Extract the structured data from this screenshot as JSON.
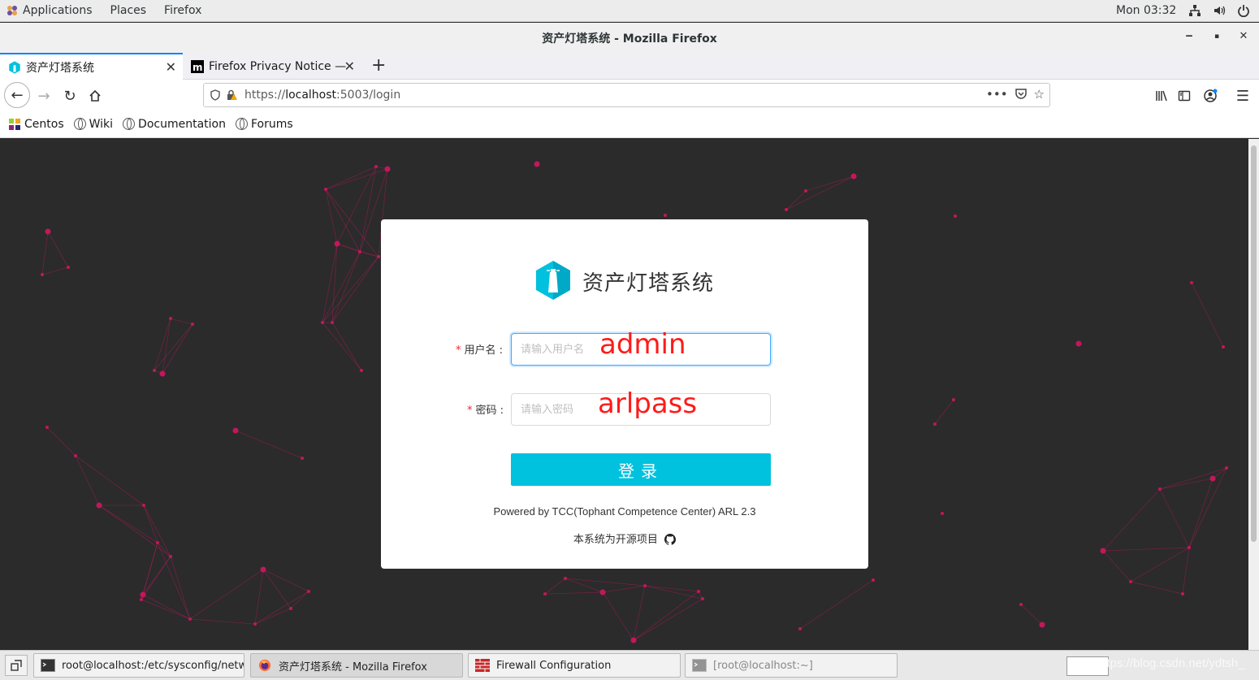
{
  "topbar": {
    "applications": "Applications",
    "places": "Places",
    "firefox": "Firefox",
    "clock": "Mon 03:32"
  },
  "window": {
    "title": "资产灯塔系统 - Mozilla Firefox",
    "minimize": "‒",
    "maximize": "▪",
    "close": "✕"
  },
  "tabs": [
    {
      "label": "资产灯塔系统",
      "active": true
    },
    {
      "label": "Firefox Privacy Notice —",
      "active": false
    }
  ],
  "url": {
    "scheme": "https://",
    "host": "localhost",
    "rest": ":5003/login"
  },
  "bookmarks": [
    "Centos",
    "Wiki",
    "Documentation",
    "Forums"
  ],
  "login": {
    "brand": "资产灯塔系统",
    "username_label": "用户名",
    "username_placeholder": "请输入用户名",
    "password_label": "密码",
    "password_placeholder": "请输入密码",
    "colon": ":",
    "required_mark": "*",
    "button": "登录",
    "powered_by": "Powered by TCC(Tophant Competence Center) ARL 2.3",
    "open_source": "本系统为开源项目",
    "annotation_username": "admin",
    "annotation_password": "arlpass"
  },
  "taskbar": [
    {
      "label": "root@localhost:/etc/sysconfig/netw...",
      "icon": "terminal-icon"
    },
    {
      "label": "资产灯塔系统 - Mozilla Firefox",
      "icon": "firefox-icon"
    },
    {
      "label": "Firewall Configuration",
      "icon": "firewall-icon"
    },
    {
      "label": "[root@localhost:~]",
      "icon": "terminal-icon"
    }
  ],
  "watermark": "https://blog.csdn.net/ydtsh_",
  "colors": {
    "accent": "#00c1de",
    "background": "#2b2b2b",
    "network": "#c2185b",
    "annotation": "#ff1a1a"
  }
}
